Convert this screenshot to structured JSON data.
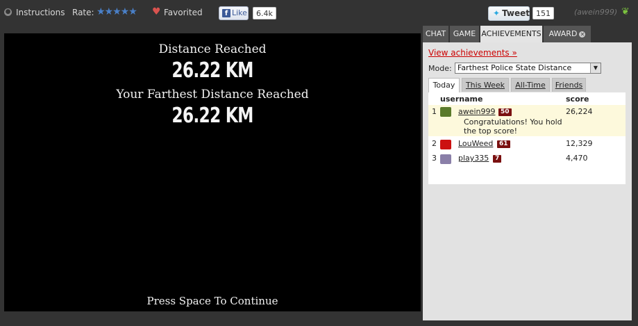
{
  "topbar": {
    "instructions_label": "Instructions",
    "rate_label": "Rate:",
    "stars": "★★★★★",
    "favorited_label": "Favorited",
    "like_label": "Like",
    "like_count": "6.4k",
    "tweet_label": "Tweet",
    "tweet_count": "151",
    "username": "(awein999)"
  },
  "game": {
    "distance_label": "Distance Reached",
    "distance_value": "26.22 KM",
    "farthest_label": "Your Farthest Distance Reached",
    "farthest_value": "26.22 KM",
    "continue_prompt": "Press Space To Continue"
  },
  "panel": {
    "tabs": [
      {
        "label": "CHAT"
      },
      {
        "label": "GAME"
      },
      {
        "label": "ACHIEVEMENTS"
      },
      {
        "label": "AWARD"
      }
    ],
    "active_tab": "ACHIEVEMENTS",
    "view_achievements": "View achievements »",
    "mode_label": "Mode:",
    "mode_value": "Farthest Police State Distance",
    "leaderboard_tabs": [
      {
        "label": "Today"
      },
      {
        "label": "This Week"
      },
      {
        "label": "All-Time"
      },
      {
        "label": "Friends"
      }
    ],
    "active_leaderboard_tab": "Today",
    "columns": {
      "username": "username",
      "score": "score"
    },
    "rows": [
      {
        "rank": "1",
        "username": "awein999",
        "level": "50",
        "score": "26,224",
        "note": "Congratulations! You hold the top score!",
        "avatar_color": "#5a7a2a"
      },
      {
        "rank": "2",
        "username": "LouWeed",
        "level": "61",
        "score": "12,329",
        "avatar_color": "#cc1111"
      },
      {
        "rank": "3",
        "username": "play335",
        "level": "7",
        "score": "4,470",
        "avatar_color": "#8a7fa8"
      }
    ]
  },
  "colors": {
    "accent_link": "#cc0000",
    "level_badge": "#7a1010",
    "highlight_row": "#fdf9dc"
  }
}
